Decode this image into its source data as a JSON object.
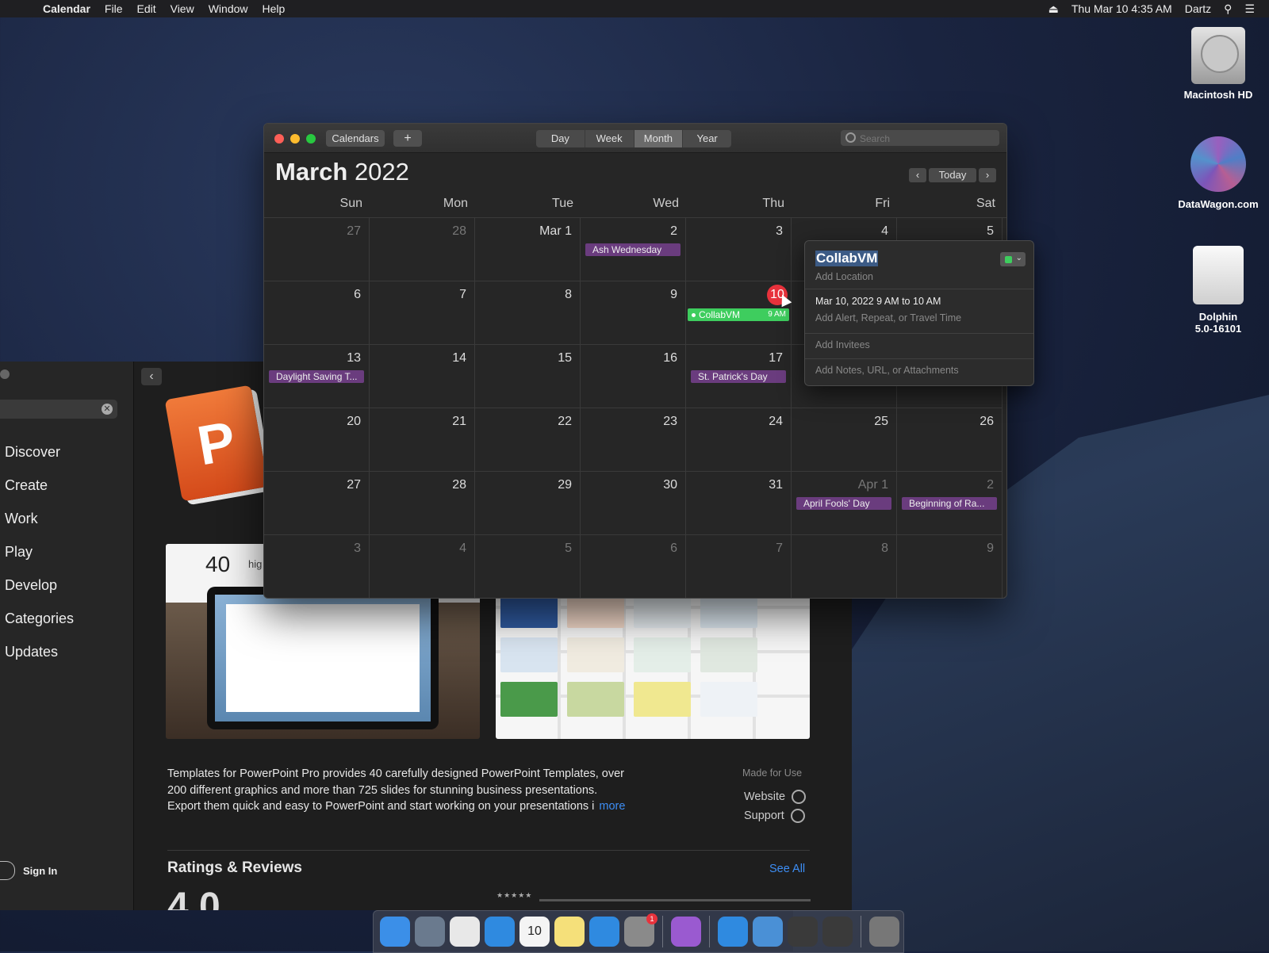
{
  "menubar": {
    "app_name": "Calendar",
    "menus": [
      "File",
      "Edit",
      "View",
      "Window",
      "Help"
    ],
    "datetime": "Thu Mar 10  4:35 AM",
    "user": "Dartz"
  },
  "desktop_icons": [
    {
      "label": "Macintosh HD",
      "icon": "hard-drive-icon"
    },
    {
      "label": "DataWagon.com",
      "icon": "datawagon-icon"
    },
    {
      "label": "Dolphin\n5.0-16101",
      "label_line1": "Dolphin",
      "label_line2": "5.0-16101",
      "icon": "disk-image-icon"
    }
  ],
  "calendar": {
    "calendars_button": "Calendars",
    "add_button": "+",
    "view_tabs": [
      "Day",
      "Week",
      "Month",
      "Year"
    ],
    "active_view": "Month",
    "search_placeholder": "Search",
    "month": "March",
    "year": "2022",
    "today_button": "Today",
    "prev_glyph": "‹",
    "next_glyph": "›",
    "weekdays": [
      "Sun",
      "Mon",
      "Tue",
      "Wed",
      "Thu",
      "Fri",
      "Sat"
    ],
    "weeks": [
      [
        {
          "d": "27",
          "dim": true
        },
        {
          "d": "28",
          "dim": true
        },
        {
          "d": "Mar 1"
        },
        {
          "d": "2",
          "event": "Ash Wednesday"
        },
        {
          "d": "3"
        },
        {
          "d": "4"
        },
        {
          "d": "5"
        }
      ],
      [
        {
          "d": "6"
        },
        {
          "d": "7"
        },
        {
          "d": "8"
        },
        {
          "d": "9"
        },
        {
          "d": "10",
          "today": true,
          "event": "CollabVM",
          "event_time": "9 AM",
          "event_color": "green"
        },
        {
          "d": "11"
        },
        {
          "d": "12"
        }
      ],
      [
        {
          "d": "13",
          "event": "Daylight Saving T..."
        },
        {
          "d": "14"
        },
        {
          "d": "15"
        },
        {
          "d": "16"
        },
        {
          "d": "17",
          "event": "St. Patrick's Day"
        },
        {
          "d": "18"
        },
        {
          "d": "19"
        }
      ],
      [
        {
          "d": "20"
        },
        {
          "d": "21"
        },
        {
          "d": "22"
        },
        {
          "d": "23"
        },
        {
          "d": "24"
        },
        {
          "d": "25"
        },
        {
          "d": "26"
        }
      ],
      [
        {
          "d": "27"
        },
        {
          "d": "28"
        },
        {
          "d": "29"
        },
        {
          "d": "30"
        },
        {
          "d": "31"
        },
        {
          "d": "Apr 1",
          "dim": true,
          "event": "April Fools' Day"
        },
        {
          "d": "2",
          "dim": true,
          "event": "Beginning of Ra..."
        }
      ],
      [
        {
          "d": "3",
          "dim": true
        },
        {
          "d": "4",
          "dim": true
        },
        {
          "d": "5",
          "dim": true
        },
        {
          "d": "6",
          "dim": true
        },
        {
          "d": "7",
          "dim": true
        },
        {
          "d": "8",
          "dim": true
        },
        {
          "d": "9",
          "dim": true
        }
      ]
    ],
    "event_color_purple": "#6a3c7e",
    "event_color_green": "#3ecd5e",
    "today_color": "#e8323c"
  },
  "popover": {
    "title": "CollabVM",
    "location_placeholder": "Add Location",
    "when": "Mar 10, 2022  9 AM to 10 AM",
    "alert_placeholder": "Add Alert, Repeat, or Travel Time",
    "invitees_placeholder": "Add Invitees",
    "notes_placeholder": "Add Notes, URL, or Attachments",
    "calendar_color": "#3ecd5e"
  },
  "appstore": {
    "sidebar_items": [
      "Discover",
      "Create",
      "Work",
      "Play",
      "Develop",
      "Categories",
      "Updates"
    ],
    "sign_in": "Sign In",
    "screenshot_number": "40",
    "screenshot_text": "hig",
    "description_lines": [
      "Templates for PowerPoint Pro provides 40 carefully designed PowerPoint Templates, over",
      "200 different graphics and more than 725 slides for stunning business presentations.",
      "Export them quick and easy to PowerPoint and start working on your presentations i"
    ],
    "more_link": "more",
    "made_for": "Made for Use",
    "website_link": "Website",
    "support_link": "Support",
    "ratings_title": "Ratings & Reviews",
    "see_all": "See All",
    "rating_value": "4.0",
    "stars_label": "★★★★★"
  },
  "dock": {
    "items": [
      {
        "name": "finder-icon",
        "color": "#3b8fe8"
      },
      {
        "name": "launchpad-icon",
        "color": "#6a7a8e"
      },
      {
        "name": "chrome-icon",
        "color": "#e8e8e8"
      },
      {
        "name": "safari-icon",
        "color": "#2f8ae0"
      },
      {
        "name": "calendar-dock-icon",
        "color": "#f4f4f4",
        "label": "10"
      },
      {
        "name": "notes-icon",
        "color": "#f5e07a"
      },
      {
        "name": "app-store-icon",
        "color": "#2f8ae0"
      },
      {
        "name": "system-preferences-icon",
        "color": "#8a8a8a",
        "badge": "1"
      },
      {
        "name": "flask-icon",
        "color": "#9a5ad0"
      },
      {
        "name": "app-store-2-icon",
        "color": "#2f8ae0"
      },
      {
        "name": "dolphin-emulator-icon",
        "color": "#4a90d6"
      },
      {
        "name": "window-icon-1",
        "color": "#3a3a3a"
      },
      {
        "name": "window-icon-2",
        "color": "#3a3a3a"
      },
      {
        "name": "trash-icon",
        "color": "#777"
      }
    ]
  }
}
